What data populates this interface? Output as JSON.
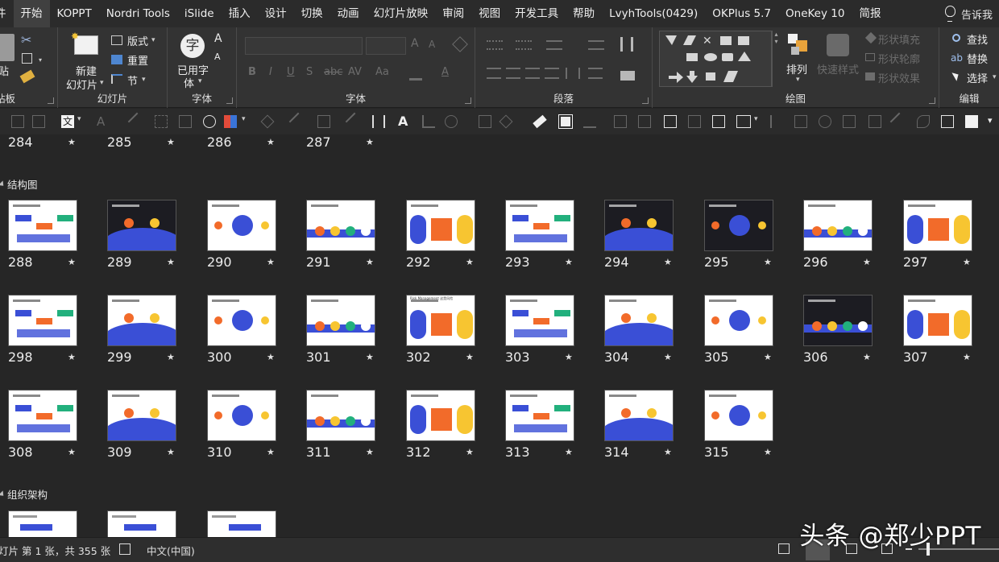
{
  "menu": {
    "tabs": [
      "件",
      "开始",
      "KOPPT",
      "Nordri Tools",
      "iSlide",
      "插入",
      "设计",
      "切换",
      "动画",
      "幻灯片放映",
      "审阅",
      "视图",
      "开发工具",
      "帮助",
      "LvyhTools(0429)",
      "OKPlus 5.7",
      "OneKey 10",
      "简报"
    ],
    "active_index": 1,
    "tell_me": "告诉我"
  },
  "ribbon": {
    "clipboard_label": "贴板",
    "clipboard_paste_partial": "贴",
    "slides_label": "幻灯片",
    "new_slide_line1": "新建",
    "new_slide_line2": "幻灯片",
    "layout": "版式",
    "reset": "重置",
    "section": "节",
    "used_font_group_label": "字体",
    "used_font_line1": "已用字",
    "used_font_line2": "体",
    "used_font_icon_char": "字",
    "font_group_label": "字体",
    "paragraph_label": "段落",
    "drawing_label": "绘图",
    "arrange": "排列",
    "quick_styles": "快速样式",
    "shape_fill": "形状填充",
    "shape_outline": "形状轮廓",
    "shape_effects": "形状效果",
    "editing_label": "编辑",
    "find": "查找",
    "replace": "替换",
    "select": "选择",
    "font_size_up": "A",
    "font_size_down": "A",
    "aa_label": "Aa"
  },
  "sorter": {
    "top_row_numbers": [
      "284",
      "285",
      "286",
      "287"
    ],
    "sections": [
      {
        "title": "结构图"
      },
      {
        "title": "组织架构"
      }
    ],
    "rows": [
      [
        "288",
        "289",
        "290",
        "291",
        "292",
        "293",
        "294",
        "295",
        "296",
        "297"
      ],
      [
        "298",
        "299",
        "300",
        "301",
        "302",
        "303",
        "304",
        "305",
        "306",
        "307"
      ],
      [
        "308",
        "309",
        "310",
        "311",
        "312",
        "313",
        "314",
        "315"
      ]
    ],
    "star_glyph": "★",
    "thumb_302_text": "Risk Management 这是风险"
  },
  "status": {
    "slide_info": "灯片 第 1 张，共 355 张",
    "language": "中文(中国)"
  },
  "watermark": "头条 @郑少PPT",
  "colors": {
    "accent_blue": "#3a4fd6",
    "accent_orange": "#f26b2a",
    "accent_yellow": "#f7c531",
    "accent_green": "#22b07d"
  }
}
